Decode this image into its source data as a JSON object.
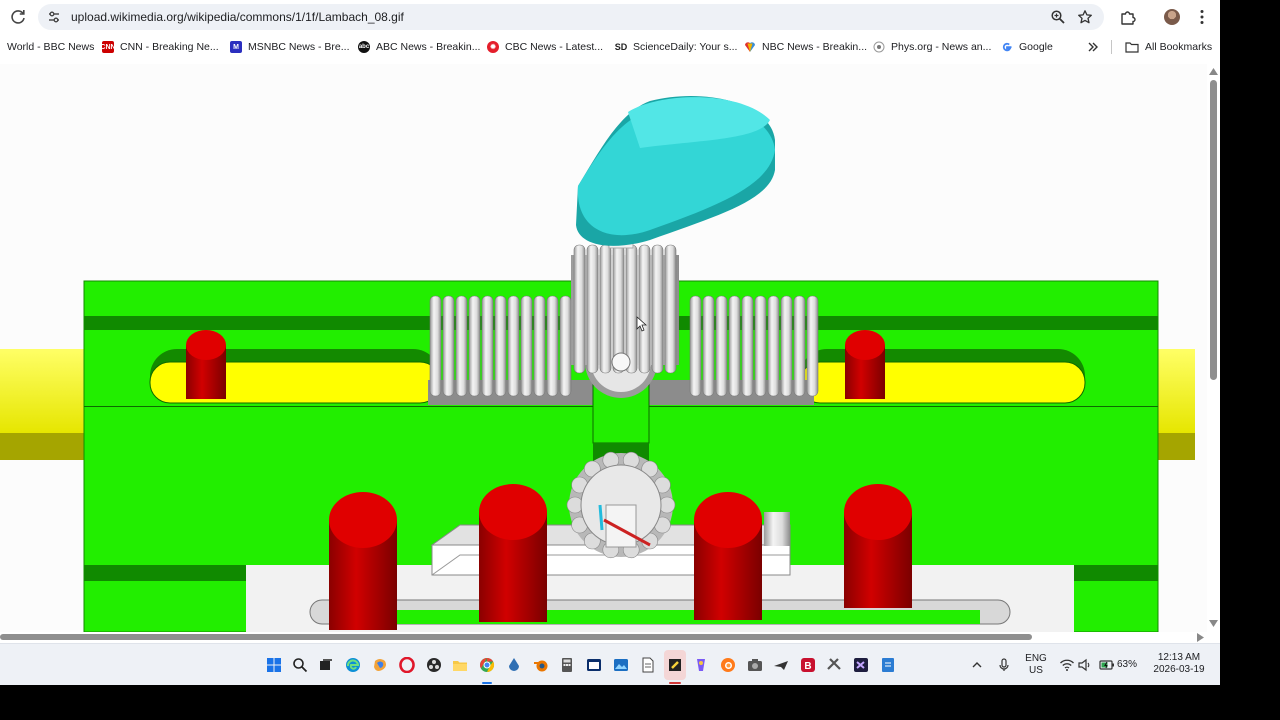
{
  "browser": {
    "url": "upload.wikimedia.org/wikipedia/commons/1/1f/Lambach_08.gif",
    "icons": [
      "reload-icon",
      "site-info-icon",
      "zoom-icon",
      "star-icon",
      "extensions-icon",
      "profile-avatar",
      "kebab-menu-icon"
    ]
  },
  "bookmarks": {
    "items": [
      {
        "label": "World - BBC News",
        "favicon": "bbc"
      },
      {
        "label": "CNN - Breaking Ne...",
        "favicon": "cnn"
      },
      {
        "label": "MSNBC News - Bre...",
        "favicon": "msnbc"
      },
      {
        "label": "ABC News - Breakin...",
        "favicon": "abc"
      },
      {
        "label": "CBC News - Latest...",
        "favicon": "cbc"
      },
      {
        "label": "ScienceDaily: Your s...",
        "favicon": "sciencedaily"
      },
      {
        "label": "NBC News - Breakin...",
        "favicon": "nbc"
      },
      {
        "label": "Phys.org - News an...",
        "favicon": "physorg"
      },
      {
        "label": "Google",
        "favicon": "google"
      }
    ],
    "all_bookmarks": "All Bookmarks"
  },
  "image": {
    "subject": "animated mechanism: cam, gear racks and pinions, sliding frame",
    "colors": {
      "frame": "#22ee00",
      "slide": "#ffff00",
      "cam": "#26c4c4",
      "pins": "#cc0000",
      "gear": "#e8e8e8"
    }
  },
  "taskbar": {
    "apps": [
      "windows-start",
      "search",
      "task-view",
      "edge",
      "copilot",
      "opera",
      "obs",
      "file-explorer",
      "chrome",
      "app-blue",
      "blender",
      "calculator",
      "terminal",
      "photos",
      "notepad",
      "sticky-notes",
      "paint",
      "firefox",
      "camera",
      "app-jet",
      "app-b",
      "app-tools",
      "visual-studio",
      "app-doc"
    ],
    "language_line1": "ENG",
    "language_line2": "US",
    "battery": "63%",
    "time": "12:13 AM",
    "date": "2026-03-19"
  }
}
